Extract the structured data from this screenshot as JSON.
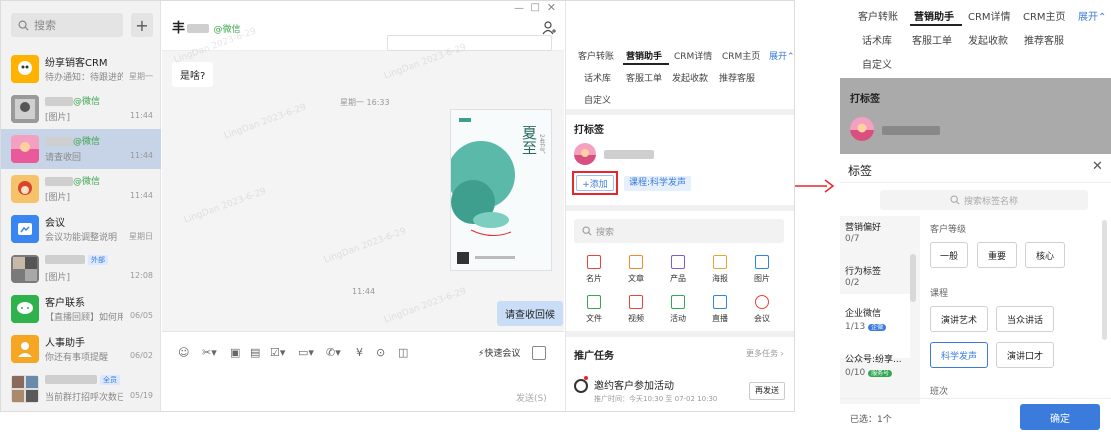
{
  "search": {
    "placeholder": "搜索"
  },
  "conversations": [
    {
      "title": "纷享销客CRM",
      "sub": "待办通知：待跟进的...",
      "time": "星期一"
    },
    {
      "tag": "@微信",
      "sub": "[图片]",
      "time": "11:44"
    },
    {
      "tag": "@微信",
      "sub": "请查收回",
      "time": "11:44"
    },
    {
      "tag": "@微信",
      "sub": "[图片]",
      "time": "11:44"
    },
    {
      "title": "会议",
      "sub": "会议功能调整说明",
      "time": "星期日"
    },
    {
      "badge": "外部",
      "sub": "[图片]",
      "time": "12:08"
    },
    {
      "title": "客户联系",
      "sub": "【直播回顾】如何用...",
      "time": "06/05"
    },
    {
      "title": "人事助手",
      "sub": "你还有事项提醒",
      "time": "06/02"
    },
    {
      "badge": "全员",
      "sub": "当前群打招呼次数已...",
      "time": "05/19"
    }
  ],
  "chat": {
    "header_name": "丰",
    "header_tag": "@微信",
    "msg_whathappen": "是啥?",
    "time_1": "星期一 16:33",
    "time_2": "11:44",
    "msg_received": "请查收回候",
    "poster_title": "夏至",
    "poster_sub": "24节气",
    "quick_meeting": "快速会议",
    "send": "发送(S)",
    "watermark": "LingDan 2023-6-29"
  },
  "sidebar": {
    "tabs_row1": [
      "客户转账",
      "营销助手",
      "CRM详情",
      "CRM主页",
      "展开"
    ],
    "tabs_row2": [
      "话术库",
      "客服工单",
      "发起收款",
      "推荐客服"
    ],
    "tabs_row3": [
      "自定义"
    ],
    "tag_title": "打标签",
    "add_btn": "+添加",
    "course_tag": "课程:科学发声",
    "search_placeholder": "搜索",
    "grid": [
      {
        "label": "名片",
        "color": "#e8443a"
      },
      {
        "label": "文章",
        "color": "#f08a2b"
      },
      {
        "label": "产品",
        "color": "#7b5cd6"
      },
      {
        "label": "海报",
        "color": "#f0a22b"
      },
      {
        "label": "图片",
        "color": "#2b86e8"
      },
      {
        "label": "文件",
        "color": "#32a852"
      },
      {
        "label": "视频",
        "color": "#e8443a"
      },
      {
        "label": "活动",
        "color": "#32a852"
      },
      {
        "label": "直播",
        "color": "#2b86e8"
      },
      {
        "label": "会议",
        "color": "#e8443a"
      }
    ],
    "push_title": "推广任务",
    "more_tasks": "更多任务",
    "task_title": "邀约客户参加活动",
    "task_time": "推广时间：今天10:30 至 07-02 10:30",
    "resend": "再发送"
  },
  "panel": {
    "tabs_row1": [
      "客户转账",
      "营销助手",
      "CRM详情",
      "CRM主页",
      "展开"
    ],
    "tabs_row2": [
      "话术库",
      "客服工单",
      "发起收款",
      "推荐客服"
    ],
    "tabs_row3": [
      "自定义"
    ],
    "tag_title": "打标签",
    "dialog_title": "标签",
    "search_placeholder": "搜索标签名称",
    "categories": [
      {
        "name": "营销偏好",
        "count": "0/7"
      },
      {
        "name": "行为标签",
        "count": "0/2"
      },
      {
        "name": "企业微信",
        "count": "1/13",
        "badge": "企微"
      },
      {
        "name": "公众号:纷享...",
        "count": "0/10",
        "badge": "服务号"
      }
    ],
    "group1_title": "客户等级",
    "group1_chips": [
      "一般",
      "重要",
      "核心"
    ],
    "group2_title": "课程",
    "group2_chips": [
      "演讲艺术",
      "当众讲话",
      "科学发声",
      "演讲口才"
    ],
    "group3_title": "班次",
    "selected": "已选：1个",
    "confirm": "确定"
  },
  "colors": {
    "accent": "#3a7bdc",
    "highlight": "#e8262b",
    "chat_bg": "#f4f4f4",
    "list_bg": "#f2f2f2"
  }
}
